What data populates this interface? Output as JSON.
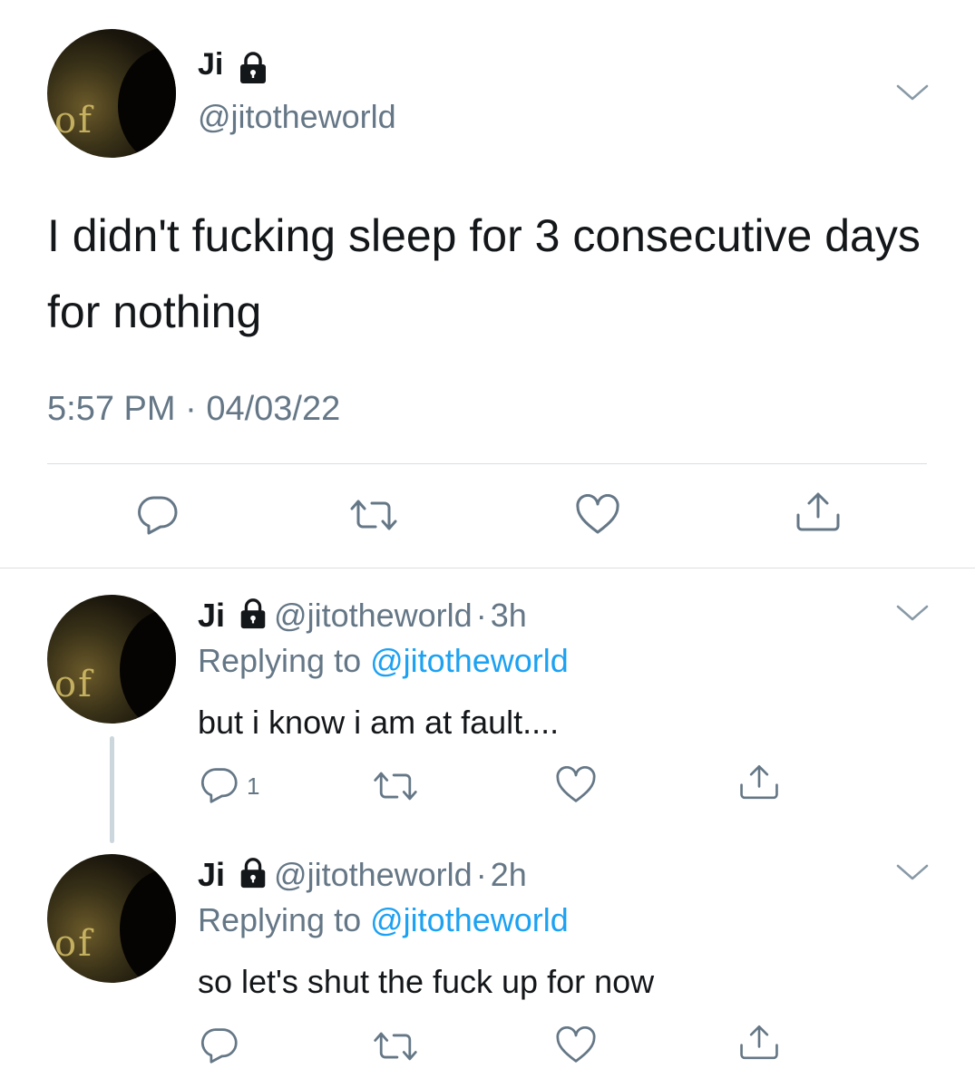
{
  "main_tweet": {
    "name": "Ji",
    "handle": "@jitotheworld",
    "text": "I didn't fucking sleep for 3 consecutive days for nothing",
    "time": "5:57 PM",
    "separator": "·",
    "date": "04/03/22",
    "actions": [
      "reply-icon",
      "retweet-icon",
      "like-icon",
      "share-icon"
    ]
  },
  "replies": [
    {
      "name": "Ji",
      "handle": "@jitotheworld",
      "separator": "·",
      "age": "3h",
      "replying_prefix": "Replying to",
      "replying_to": "@jitotheworld",
      "text": "but i know i am at fault....",
      "reply_count": "1"
    },
    {
      "name": "Ji",
      "handle": "@jitotheworld",
      "separator": "·",
      "age": "2h",
      "replying_prefix": "Replying to",
      "replying_to": "@jitotheworld",
      "text": "so let's shut the fuck up for now",
      "reply_count": ""
    }
  ],
  "colors": {
    "text": "#14171a",
    "muted": "#657786",
    "link": "#1da1f2",
    "divider": "#d9dee2"
  }
}
